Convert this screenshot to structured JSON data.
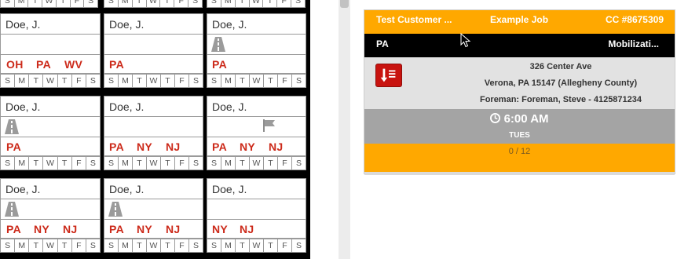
{
  "days": [
    "S",
    "M",
    "T",
    "W",
    "T",
    "F",
    "S"
  ],
  "crew": [
    {
      "name": "Doe, J.",
      "icon": "",
      "states": [
        "OH",
        "PA",
        "WV"
      ]
    },
    {
      "name": "Doe, J.",
      "icon": "",
      "states": [
        "PA"
      ]
    },
    {
      "name": "Doe, J.",
      "icon": "road-icon",
      "states": [
        "PA"
      ]
    },
    {
      "name": "Doe, J.",
      "icon": "road-icon",
      "states": [
        "PA"
      ]
    },
    {
      "name": "Doe, J.",
      "icon": "",
      "states": [
        "PA",
        "NY",
        "NJ"
      ]
    },
    {
      "name": "Doe, J.",
      "icon": "flag-icon",
      "states": [
        "PA",
        "NY",
        "NJ"
      ]
    },
    {
      "name": "Doe, J.",
      "icon": "road-icon",
      "states": [
        "PA",
        "NY",
        "NJ"
      ]
    },
    {
      "name": "Doe, J.",
      "icon": "road-icon",
      "states": [
        "PA",
        "NY",
        "NJ"
      ]
    },
    {
      "name": "Doe, J.",
      "icon": "",
      "states": [
        "NY",
        "NJ"
      ]
    }
  ],
  "job_card": {
    "customer": "Test Customer ...",
    "job": "Example Job",
    "cc": "CC #8675309",
    "state": "PA",
    "phase": "Mobilizati...",
    "address_line1": "326 Center Ave",
    "address_line2": "Verona, PA 15147 (Allegheny County)",
    "foreman": "Foreman: Foreman, Steve - 4125871234",
    "time": "6:00 AM",
    "day": "TUES",
    "progress": "0 / 12",
    "document_icon": "pdf-icon"
  },
  "colors": {
    "accent": "#ffa800",
    "state_text": "#cc2a1a",
    "header_bar": "#000000",
    "time_bar": "#a4a4a4"
  }
}
